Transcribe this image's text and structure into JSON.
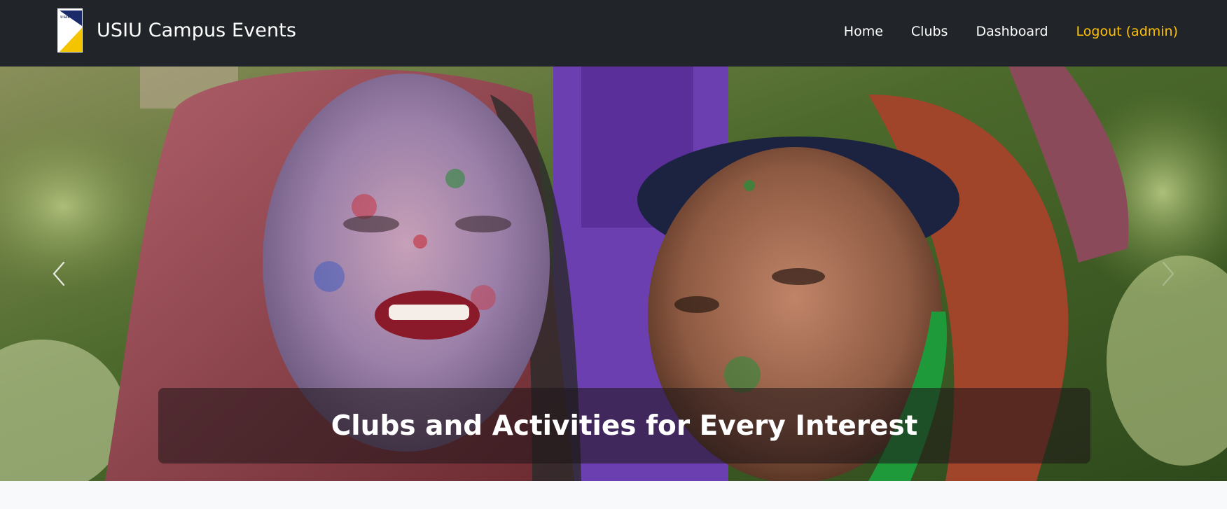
{
  "navbar": {
    "brand": "USIU Campus Events",
    "logo_text": "USIU",
    "links": [
      {
        "label": "Home"
      },
      {
        "label": "Clubs"
      },
      {
        "label": "Dashboard"
      },
      {
        "label": "Logout (admin)"
      }
    ]
  },
  "hero": {
    "caption": "Clubs and Activities for Every Interest"
  },
  "colors": {
    "navbar_bg": "#212529",
    "logout_accent": "#ffc107",
    "page_bg": "#f8f9fa"
  }
}
